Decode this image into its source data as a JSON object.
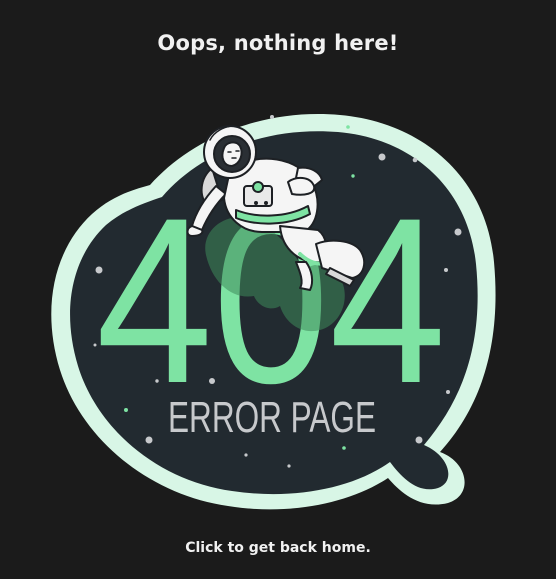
{
  "page": {
    "heading": "Oops, nothing here!",
    "home_link_label": "Click to get back home."
  },
  "illustration": {
    "code_text": "404",
    "caption": "ERROR PAGE",
    "icon": "astronaut-icon"
  },
  "colors": {
    "background": "#1b1b1b",
    "blob_fill": "#222a30",
    "blob_outline": "#d8f6e6",
    "accent_green": "#7ee3a3",
    "caption_gray": "#c7c9cc",
    "text": "#f1f1f1"
  }
}
